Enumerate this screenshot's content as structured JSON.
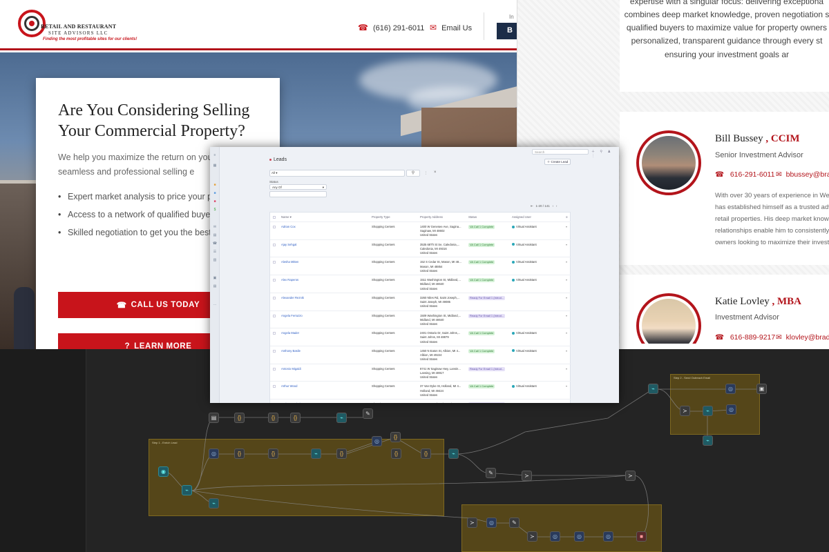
{
  "website": {
    "logo": {
      "name": "RETAIL AND RESTAURANT",
      "sub": "SITE ADVISORS LLC",
      "tagline": "Finding the most profitable sites for our clients!"
    },
    "header": {
      "phone": "(616) 291-6011",
      "email_label": "Email Us",
      "small_text": "In",
      "badge_text": "B"
    },
    "hero": {
      "title": "Are You Considering Selling Your Commercial Property?",
      "intro": "We help you maximize the return on your i with a seamless and professional selling e",
      "bullets": [
        "Expert market analysis to price your pro effectively.",
        "Access to a network of qualified buyers.",
        "Skilled negotiation to get you the best p price."
      ],
      "cta_call": "CALL US TODAY",
      "cta_learn": "LEARN MORE"
    }
  },
  "team": {
    "top_bio": [
      "expertise with a singular focus: delivering exceptiona",
      "combines deep market knowledge, proven negotiation s",
      "qualified buyers to maximize value for property owners",
      "personalized, transparent guidance through every st",
      "ensuring your investment goals ar"
    ],
    "members": [
      {
        "name": "Bill Bussey",
        "credential": ", CCIM",
        "title": "Senior Investment Advisor",
        "phone": "616-291-6011",
        "email": "bbussey@brad",
        "bio": [
          "With over 30 years of experience in We",
          "has established himself as a trusted adv",
          "retail properties. His deep market knowl",
          "relationships enable him to consistently",
          "owners looking to maximize their invest"
        ]
      },
      {
        "name": "Katie Lovley",
        "credential": ", MBA",
        "title": "Investment Advisor",
        "phone": "616-889-9217",
        "email": "klovley@bradl"
      }
    ]
  },
  "crm": {
    "page_title": "Leads",
    "search_placeholder": "Search",
    "create_button": "Create Lead",
    "filter_all": "All",
    "status_label": "Status",
    "status_value": "Any Of",
    "pager": "1-20 / 141",
    "columns": [
      "Name",
      "Property Type",
      "Property Address",
      "Status",
      "Assigned User"
    ],
    "rows": [
      {
        "name": "Adrian Cox",
        "type": "Shopping Centers",
        "address": [
          "1400 W Genesee Ave, Sagina...",
          "Saginaw, MI 48602",
          "United States"
        ],
        "status": "VA Call 1 Complete",
        "status_kind": "g",
        "assigned": "Virtual Assistant"
      },
      {
        "name": "Ajay Sehgal",
        "type": "Shopping Centers",
        "address": [
          "3535 68Th St Se, Caledonia,...",
          "Caledonia, MI 49316",
          "United States"
        ],
        "status": "VA Call 1 Complete",
        "status_kind": "g",
        "assigned": "Virtual Assistant"
      },
      {
        "name": "Alesha Mitten",
        "type": "Shopping Centers",
        "address": [
          "152 S Cedar St, Mason, MI 48...",
          "Mason, MI 48854",
          "United States"
        ],
        "status": "VA Call 1 Complete",
        "status_kind": "g",
        "assigned": "Virtual Assistant"
      },
      {
        "name": "Alex Raperos",
        "type": "Shopping Centers",
        "address": [
          "1511 Washington St, Midland,...",
          "Midland, MI 48640",
          "United States"
        ],
        "status": "VA Call 1 Complete",
        "status_kind": "g",
        "assigned": "Virtual Assistant"
      },
      {
        "name": "Alexander Reznik",
        "type": "Shopping Centers",
        "address": [
          "3260 Niles Rd, Saint Joseph,...",
          "Saint Joseph, MI 49085",
          "United States"
        ],
        "status": "Ready For Email 1 (Introd...",
        "status_kind": "p",
        "assigned": ""
      },
      {
        "name": "Angela Ferrazzo",
        "type": "Shopping Centers",
        "address": [
          "1509 Washington St, Midland,...",
          "Midland, MI 48640",
          "United States"
        ],
        "status": "Ready For Email 1 (Introd...",
        "status_kind": "p",
        "assigned": ""
      },
      {
        "name": "Angela Mader",
        "type": "Shopping Centers",
        "address": [
          "2401 Ontario Dr, Saint Johns,...",
          "Saint Johns, MI 48879",
          "United States"
        ],
        "status": "VA Call 1 Complete",
        "status_kind": "g",
        "assigned": "Virtual Assistant"
      },
      {
        "name": "Anthony Basile",
        "type": "Shopping Centers",
        "address": [
          "1450 N Eaton St, Albion, MI 4...",
          "Albion, MI 49224",
          "United States"
        ],
        "status": "VA Call 1 Complete",
        "status_kind": "g",
        "assigned": "Virtual Assistant"
      },
      {
        "name": "Antonio Migaldi",
        "type": "Shopping Centers",
        "address": [
          "8741 W Saginaw Hwy, Lansin...",
          "Lansing, MI 48917",
          "United States"
        ],
        "status": "Ready For Email 1 (Introd...",
        "status_kind": "p",
        "assigned": ""
      },
      {
        "name": "Arthur Wood",
        "type": "Shopping Centers",
        "address": [
          "37 Van Dyke St, Holland, MI 4...",
          "Holland, MI 49424",
          "United States"
        ],
        "status": "VA Call 1 Complete",
        "status_kind": "g",
        "assigned": "Virtual Assistant"
      },
      {
        "name": "Barbara Wakeley",
        "type": "Shopping Centers",
        "address": [
          "321 S Waverly Rd, Lansing, M...",
          "",
          ""
        ],
        "status": "Ready For Email 1 (Introd...",
        "status_kind": "p",
        "assigned": ""
      }
    ]
  },
  "workflow": {
    "group_labels": [
      "Step 1 - Enrich Lead",
      "Step 2 - Send Outreach Email"
    ]
  },
  "colors": {
    "brand_red": "#c8141b",
    "crm_bg": "#eef1f6",
    "canvas": "#242424",
    "group": "#7a5f12"
  }
}
